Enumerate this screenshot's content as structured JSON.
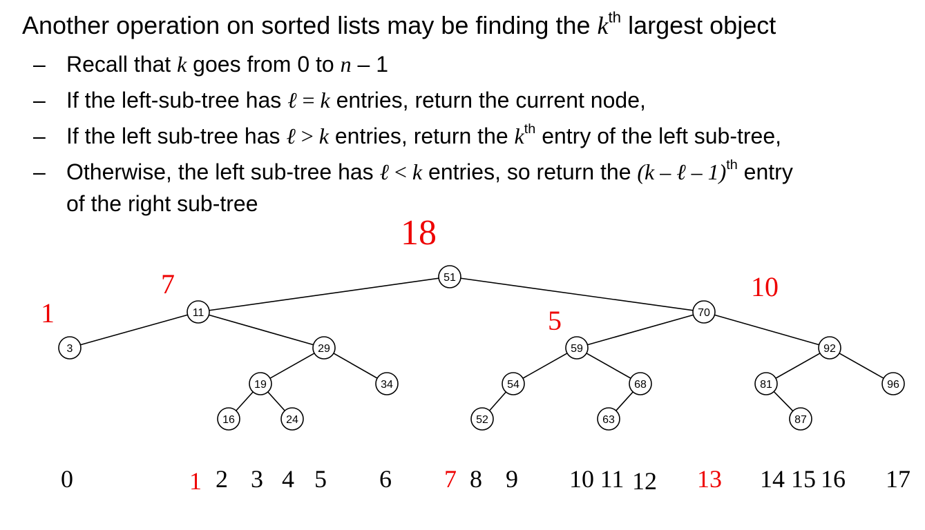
{
  "title": {
    "part1": "Another operation on sorted lists may be finding the ",
    "k": "k",
    "sup": "th",
    "part2": " largest object"
  },
  "bullets": {
    "dash": "–",
    "b1": {
      "a": "Recall that ",
      "k": "k",
      "b": " goes from 0 to ",
      "n": "n",
      "c": " – 1"
    },
    "b2": {
      "a": "If the left-sub-tree has ",
      "l": "ℓ",
      "eq": " = ",
      "k": "k",
      "b": " entries, return the current node,"
    },
    "b3": {
      "a": "If the left sub-tree has ",
      "l": "ℓ",
      "gt": " > ",
      "k": "k",
      "b": " entries, return the ",
      "k2": "k",
      "sup": "th",
      "c": " entry of the left sub-tree,"
    },
    "b4": {
      "a": "Otherwise, the left sub-tree has ",
      "l": "ℓ",
      "lt": " < ",
      "k": "k",
      "b": " entries, so return the ",
      "expr": "(k – ℓ – 1)",
      "sup": "th",
      "c": " entry",
      "line2": "of the right sub-tree"
    }
  },
  "tree": {
    "nodes": [
      "51",
      "11",
      "70",
      "3",
      "29",
      "59",
      "92",
      "19",
      "34",
      "54",
      "68",
      "81",
      "96",
      "16",
      "24",
      "52",
      "63",
      "87"
    ],
    "edges": [
      [
        "51",
        "11"
      ],
      [
        "51",
        "70"
      ],
      [
        "11",
        "3"
      ],
      [
        "11",
        "29"
      ],
      [
        "29",
        "19"
      ],
      [
        "29",
        "34"
      ],
      [
        "19",
        "16"
      ],
      [
        "19",
        "24"
      ],
      [
        "70",
        "59"
      ],
      [
        "70",
        "92"
      ],
      [
        "59",
        "54"
      ],
      [
        "59",
        "68"
      ],
      [
        "54",
        "52"
      ],
      [
        "68",
        "63"
      ],
      [
        "92",
        "81"
      ],
      [
        "92",
        "96"
      ],
      [
        "81",
        "87"
      ]
    ],
    "subtree_counts": [
      "18",
      "7",
      "10",
      "1",
      "5"
    ],
    "indices": [
      "0",
      "1",
      "2",
      "3",
      "4",
      "5",
      "6",
      "7",
      "8",
      "9",
      "10",
      "11",
      "12",
      "13",
      "14",
      "15",
      "16",
      "17"
    ],
    "highlighted_indices": [
      "1",
      "7",
      "13"
    ],
    "colors": {
      "highlight": "#ee0000",
      "line": "#000000"
    }
  }
}
